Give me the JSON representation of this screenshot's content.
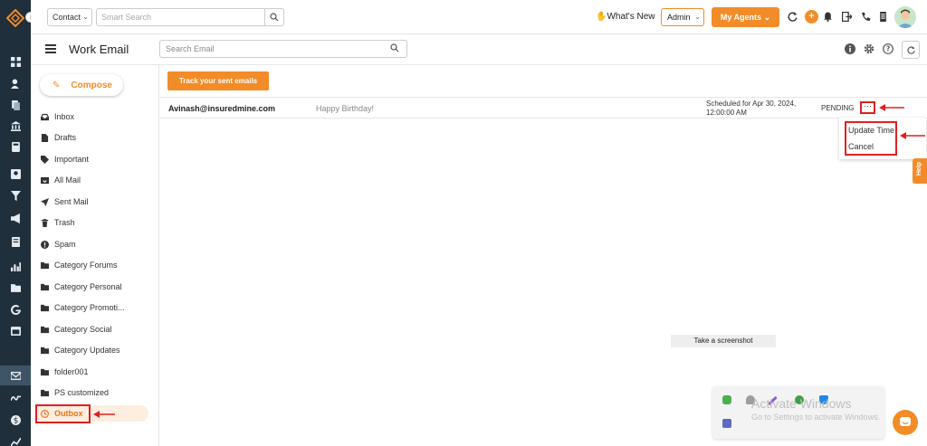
{
  "colors": {
    "accent": "#f28c28",
    "rail": "#1f2f3c",
    "highlight": "#e02020"
  },
  "topbar": {
    "contact_select": "Contact",
    "smart_search_placeholder": "Smart Search",
    "whats_new": "What's New",
    "admin_select": "Admin",
    "my_agents": "My Agents",
    "icons": [
      "refresh-icon",
      "add-icon",
      "bell-icon",
      "logout-icon",
      "phone-icon",
      "document-icon",
      "user-avatar"
    ]
  },
  "subheader": {
    "title": "Work Email",
    "search_placeholder": "Search Email",
    "icons": [
      "info-icon",
      "gear-icon",
      "help-icon",
      "refresh-icon"
    ]
  },
  "compose": {
    "label": "Compose"
  },
  "folders": [
    {
      "label": "Inbox",
      "icon": "inbox-icon"
    },
    {
      "label": "Drafts",
      "icon": "draft-icon"
    },
    {
      "label": "Important",
      "icon": "tag-icon"
    },
    {
      "label": "All Mail",
      "icon": "all-mail-icon"
    },
    {
      "label": "Sent Mail",
      "icon": "send-icon"
    },
    {
      "label": "Trash",
      "icon": "trash-icon"
    },
    {
      "label": "Spam",
      "icon": "spam-icon"
    },
    {
      "label": "Category Forums",
      "icon": "folder-icon"
    },
    {
      "label": "Category Personal",
      "icon": "folder-icon"
    },
    {
      "label": "Category Promoti...",
      "icon": "folder-icon"
    },
    {
      "label": "Category Social",
      "icon": "folder-icon"
    },
    {
      "label": "Category Updates",
      "icon": "folder-icon"
    },
    {
      "label": "folder001",
      "icon": "folder-icon"
    },
    {
      "label": "PS customized",
      "icon": "folder-icon"
    },
    {
      "label": "Outbox",
      "icon": "clock-icon",
      "active": true
    }
  ],
  "main": {
    "track_button": "Track your sent emails",
    "email": {
      "to": "Avinash@insuredmine.com",
      "subject": "Happy Birthday!",
      "scheduled_line1": "Scheduled for Apr 30, 2024,",
      "scheduled_line2": "12:00:00 AM",
      "status": "PENDING",
      "more": "···"
    },
    "dropdown": {
      "update_time": "Update Time",
      "cancel": "Cancel"
    },
    "help_tab": "Help"
  },
  "overlay": {
    "screenshot_button": "Take a screenshot",
    "activate_title": "Activate Windows",
    "activate_sub": "Go to Settings to activate Windows."
  }
}
